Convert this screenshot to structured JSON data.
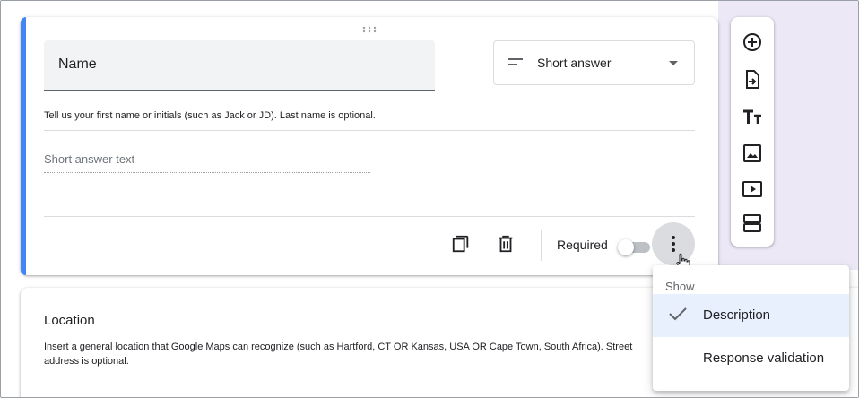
{
  "question_card": {
    "title": "Name",
    "type_select": {
      "selected": "Short answer",
      "icon": "short-answer-lines-icon"
    },
    "description": "Tell us your first name or initials (such as Jack or JD). Last name is optional.",
    "answer_placeholder": "Short answer text",
    "footer": {
      "copy_icon": "duplicate-icon",
      "delete_icon": "trash-icon",
      "required_label": "Required",
      "required_on": false,
      "more_icon": "more-vert-icon"
    },
    "accent_color": "#4285f4"
  },
  "side_toolbar": {
    "buttons": [
      {
        "name": "add-question",
        "icon": "add-circle-icon"
      },
      {
        "name": "import-questions",
        "icon": "import-icon"
      },
      {
        "name": "add-title",
        "icon": "title-icon"
      },
      {
        "name": "add-image",
        "icon": "image-icon"
      },
      {
        "name": "add-video",
        "icon": "video-icon"
      },
      {
        "name": "add-section",
        "icon": "section-icon"
      }
    ]
  },
  "location_card": {
    "title": "Location",
    "description": "Insert a general location that Google Maps can recognize (such as Hartford, CT  OR  Kansas, USA  OR  Cape Town, South Africa). Street address is optional."
  },
  "menu": {
    "header": "Show",
    "items": [
      {
        "label": "Description",
        "checked": true
      },
      {
        "label": "Response validation",
        "checked": false
      }
    ]
  }
}
